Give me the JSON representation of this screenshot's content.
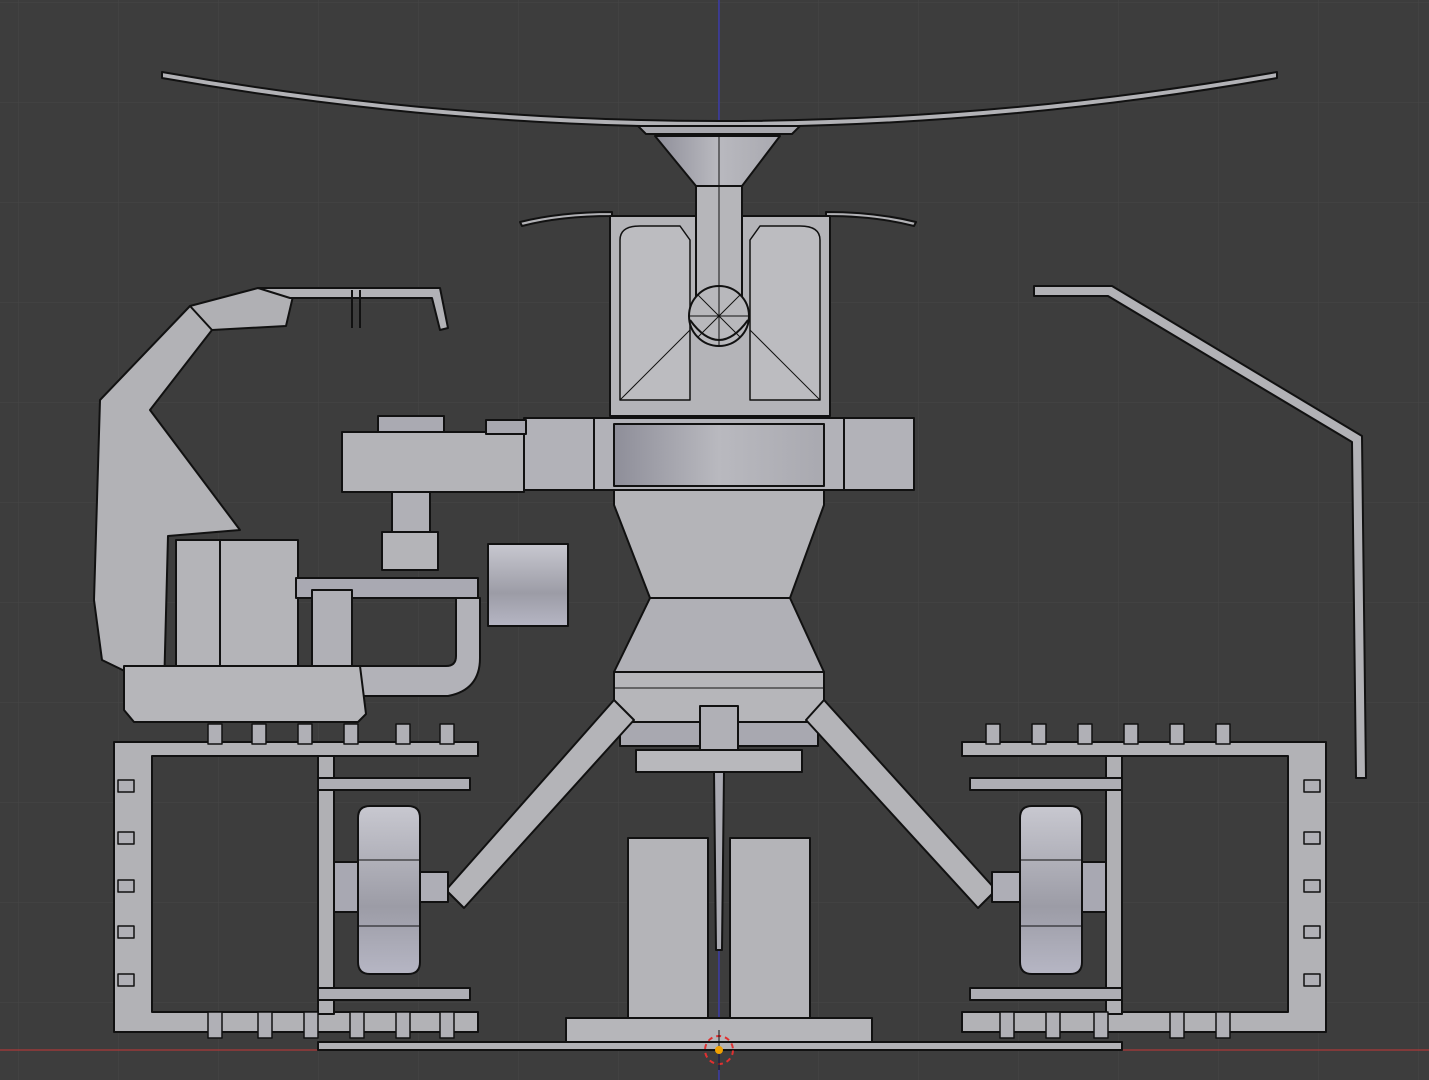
{
  "viewport": {
    "view": "front-orthographic",
    "shading": "solid",
    "overlay": "wireframe",
    "grid_visible": true
  },
  "colors": {
    "background": "#3d3d3d",
    "grid_line": "#474747",
    "x_axis": "#9a3a3a",
    "z_axis": "#3a3aa8",
    "mesh_fill": "#b2b2b6",
    "mesh_fill_dark": "#8b8b95",
    "wire": "#111111",
    "cursor_ring": "#e03030",
    "origin_dot": "#f0a000"
  },
  "model": {
    "parts": [
      "dish-reflector",
      "feed-horn",
      "radome-housing",
      "collar-ring",
      "center-body",
      "tripod-legs",
      "mast-column",
      "bracket-arm",
      "antenna-wire",
      "camera-gimbal",
      "left-rail-frame",
      "right-rail-frame",
      "left-wheel",
      "right-wheel",
      "base-plate"
    ]
  }
}
